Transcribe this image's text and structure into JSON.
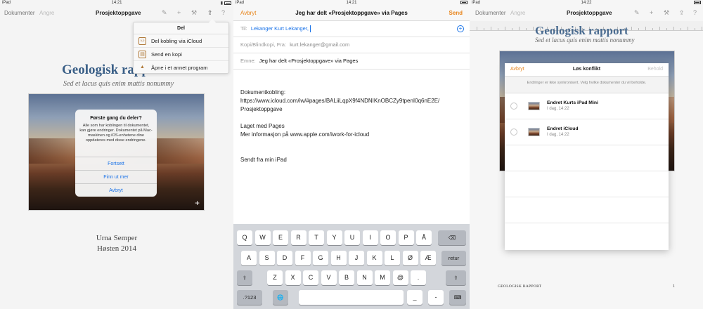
{
  "status": {
    "left": {
      "device": "iPad",
      "time": "14:21"
    },
    "middle": {
      "device": "iPad",
      "time": "14:21"
    },
    "right": {
      "device": "iPad",
      "time": "14:22"
    }
  },
  "pages_toolbar": {
    "documents": "Dokumenter",
    "undo": "Angre",
    "title": "Prosjektoppgave"
  },
  "document": {
    "title": "Geologisk rapp",
    "title_full": "Geologisk rapport",
    "subtitle": "Sed et lacus quis enim mattis nonummy",
    "author": "Urna Semper",
    "date": "Høsten 2014",
    "footer": "GEOLOGISK RAPPORT",
    "page_number": "1"
  },
  "share_popover": {
    "header": "Del",
    "items": [
      {
        "label": "Del kobling via iCloud",
        "icon": "share-link-icon"
      },
      {
        "label": "Send en kopi",
        "icon": "send-copy-icon"
      },
      {
        "label": "Åpne i et annet program",
        "icon": "open-in-icon"
      }
    ]
  },
  "alert": {
    "title": "Første gang du deler?",
    "message": "Alle som har koblingen til dokumentet, kan gjøre endringer. Dokumentet på Mac-maskinen og iOS-enhetene dine oppdateres med disse endringene.",
    "buttons": [
      "Fortsett",
      "Finn ut mer",
      "Avbryt"
    ]
  },
  "mail": {
    "cancel": "Avbryt",
    "title": "Jeg har delt «Prosjektoppgave» via Pages",
    "send": "Send",
    "to_label": "Til:",
    "to_value": "Lekanger Kurt Lekanger,",
    "cc_label": "Kopi/Blindkopi, Fra:",
    "cc_value": "kurt.lekanger@gmail.com",
    "subject_label": "Emne:",
    "subject_value": "Jeg har delt «Prosjektoppgave» via Pages",
    "body": {
      "link_label": "Dokumentkobling:",
      "link_url": "https://www.icloud.com/iw/#pages/BALiiLqpX9f4NDNIKnOBCZy9tpenI0q6nE2E/",
      "link_doc": "Prosjektoppgave",
      "made_with": "Laget med Pages",
      "more_info": "Mer informasjon på www.apple.com/iwork-for-icloud",
      "signature": "Sendt fra min iPad"
    }
  },
  "keyboard": {
    "row1": [
      "Q",
      "W",
      "E",
      "R",
      "T",
      "Y",
      "U",
      "I",
      "O",
      "P",
      "Å"
    ],
    "row2": [
      "A",
      "S",
      "D",
      "F",
      "G",
      "H",
      "J",
      "K",
      "L",
      "Ø",
      "Æ"
    ],
    "row3": [
      "Z",
      "X",
      "C",
      "V",
      "B",
      "N",
      "M",
      "@",
      "."
    ],
    "return": "retur",
    "numbers": ".?123",
    "underscore": "_",
    "dash": "-"
  },
  "conflict": {
    "cancel": "Avbryt",
    "title": "Løs konflikt",
    "keep": "Behold",
    "description": "Endringer er ikke synkronisert. Velg hvilke dokumenter du vil beholde.",
    "options": [
      {
        "title": "Endret Kurts iPad Mini",
        "subtitle": "I dag, 14:22"
      },
      {
        "title": "Endret iCloud",
        "subtitle": "I dag, 14:22"
      }
    ]
  },
  "colors": {
    "accent_orange": "#e8841a",
    "link_blue": "#1a73e8",
    "title_blue": "#3a5f87"
  }
}
